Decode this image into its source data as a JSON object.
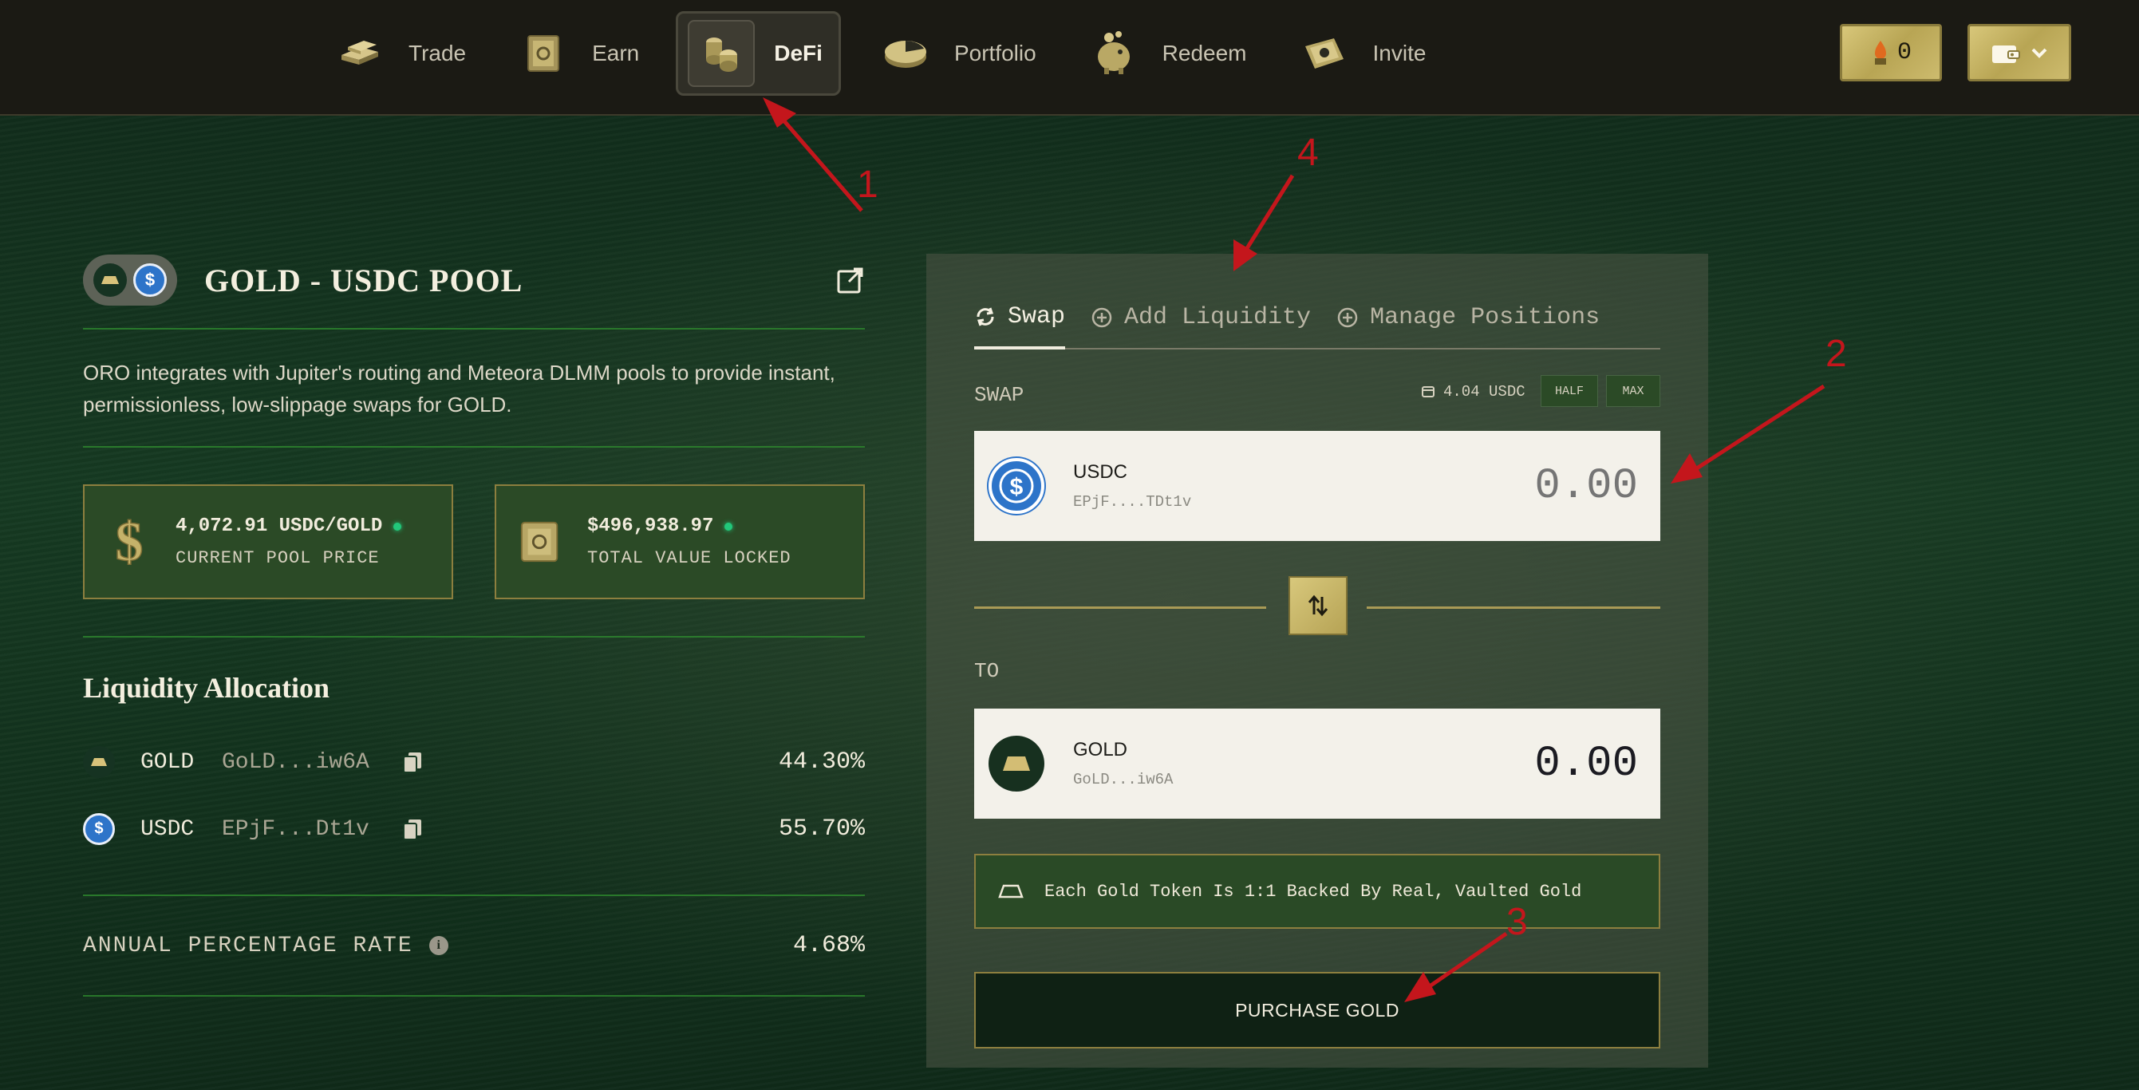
{
  "nav": {
    "items": [
      {
        "label": "Trade",
        "icon": "gold-bars-icon",
        "active": false
      },
      {
        "label": "Earn",
        "icon": "vault-icon",
        "active": false
      },
      {
        "label": "DeFi",
        "icon": "coins-icon",
        "active": true
      },
      {
        "label": "Portfolio",
        "icon": "pie-chart-icon",
        "active": false
      },
      {
        "label": "Redeem",
        "icon": "piggy-bank-icon",
        "active": false
      },
      {
        "label": "Invite",
        "icon": "ticket-icon",
        "active": false
      }
    ],
    "fuel_count": "0",
    "wallet_icon": "wallet-icon"
  },
  "pool": {
    "title": "GOLD - USDC POOL",
    "description": "ORO integrates with Jupiter's routing and Meteora DLMM pools to provide instant, permissionless, low-slippage swaps for GOLD.",
    "stats": [
      {
        "value": "4,072.91 USDC/GOLD",
        "label": "CURRENT POOL PRICE",
        "icon": "dollar-icon"
      },
      {
        "value": "$496,938.97",
        "label": "TOTAL VALUE LOCKED",
        "icon": "safe-icon"
      }
    ],
    "allocation_title": "Liquidity Allocation",
    "allocation": [
      {
        "symbol": "GOLD",
        "address": "GoLD...iw6A",
        "percent": "44.30%"
      },
      {
        "symbol": "USDC",
        "address": "EPjF...Dt1v",
        "percent": "55.70%"
      }
    ],
    "apr_label": "ANNUAL PERCENTAGE RATE",
    "apr_value": "4.68%"
  },
  "swap": {
    "tabs": [
      {
        "label": "Swap",
        "active": true
      },
      {
        "label": "Add Liquidity",
        "active": false
      },
      {
        "label": "Manage Positions",
        "active": false
      }
    ],
    "swap_label": "SWAP",
    "balance": "4.04 USDC",
    "half_label": "HALF",
    "max_label": "MAX",
    "from": {
      "symbol": "USDC",
      "address": "EPjF....TDt1v",
      "placeholder": "0.00"
    },
    "to_label": "TO",
    "to": {
      "symbol": "GOLD",
      "address": "GoLD...iw6A",
      "amount": "0.00"
    },
    "notice": "Each Gold Token Is 1:1 Backed By Real, Vaulted Gold",
    "purchase_label": "PURCHASE GOLD"
  },
  "annotations": [
    "1",
    "2",
    "3",
    "4"
  ],
  "colors": {
    "accent_gold": "#c9b765",
    "panel_green": "#2b4a26",
    "annotation_red": "#c4161c"
  }
}
